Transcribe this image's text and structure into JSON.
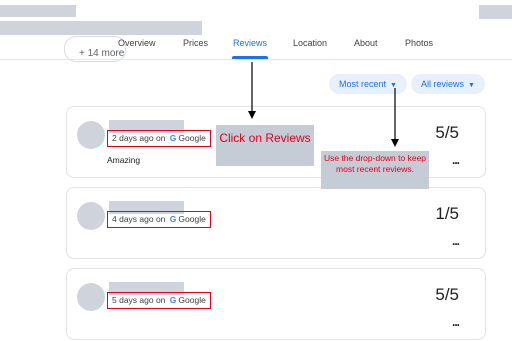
{
  "header": {
    "more_chip_label": "+ 14 more"
  },
  "tabs": [
    {
      "label": "Overview",
      "active": false
    },
    {
      "label": "Prices",
      "active": false
    },
    {
      "label": "Reviews",
      "active": true
    },
    {
      "label": "Location",
      "active": false
    },
    {
      "label": "About",
      "active": false
    },
    {
      "label": "Photos",
      "active": false
    }
  ],
  "filters": {
    "sort_label": "Most recent",
    "filter_label": "All reviews",
    "caret": "▼"
  },
  "reviews": [
    {
      "when": "2 days ago on",
      "source": "Google",
      "score": "5/5",
      "text": "Amazing",
      "menu": "..."
    },
    {
      "when": "4 days ago on",
      "source": "Google",
      "score": "1/5",
      "text": "",
      "menu": "..."
    },
    {
      "when": "5 days ago on",
      "source": "Google",
      "score": "5/5",
      "text": "",
      "menu": "..."
    }
  ],
  "annotations": {
    "click_reviews": "Click on Reviews",
    "dropdown_hint": "Use the drop-down to keep most recent reviews."
  },
  "colors": {
    "accent": "#1a73e8",
    "annotation_red": "#e3001b",
    "callout_bg": "#c6ccd6",
    "redaction": "#cfd3db"
  }
}
